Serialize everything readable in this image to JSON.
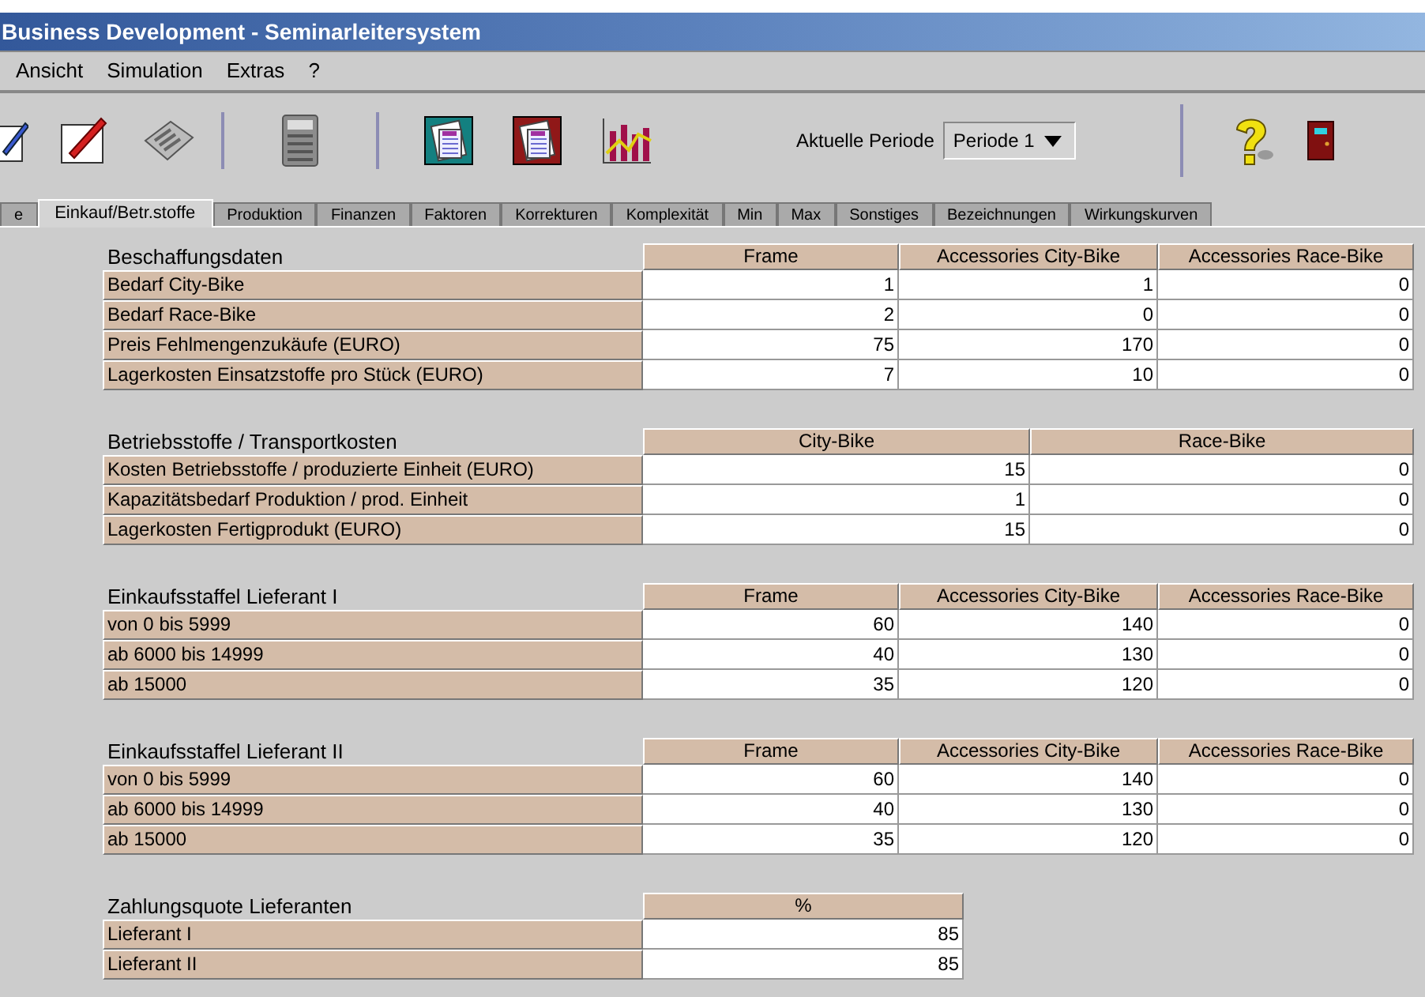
{
  "window": {
    "title": "Business Development - Seminarleitersystem"
  },
  "menu": [
    "Ansicht",
    "Simulation",
    "Extras",
    "?"
  ],
  "toolbar": {
    "period_label": "Aktuelle Periode",
    "period_value": "Periode 1"
  },
  "tabs": [
    {
      "label": "e",
      "selected": false
    },
    {
      "label": "Einkauf/Betr.stoffe",
      "selected": true
    },
    {
      "label": "Produktion",
      "selected": false
    },
    {
      "label": "Finanzen",
      "selected": false
    },
    {
      "label": "Faktoren",
      "selected": false
    },
    {
      "label": "Korrekturen",
      "selected": false
    },
    {
      "label": "Komplexität",
      "selected": false
    },
    {
      "label": "Min",
      "selected": false
    },
    {
      "label": "Max",
      "selected": false
    },
    {
      "label": "Sonstiges",
      "selected": false
    },
    {
      "label": "Bezeichnungen",
      "selected": false
    },
    {
      "label": "Wirkungskurven",
      "selected": false
    }
  ],
  "sections": [
    {
      "title": "Beschaffungsdaten",
      "columns": [
        "Frame",
        "Accessories City-Bike",
        "Accessories Race-Bike"
      ],
      "rows": [
        {
          "label": "Bedarf City-Bike",
          "cells": [
            "1",
            "1",
            "0"
          ]
        },
        {
          "label": "Bedarf Race-Bike",
          "cells": [
            "2",
            "0",
            "0"
          ]
        },
        {
          "label": "Preis Fehlmengenzukäufe (EURO)",
          "cells": [
            "75",
            "170",
            "0"
          ]
        },
        {
          "label": "Lagerkosten Einsatzstoffe pro Stück (EURO)",
          "cells": [
            "7",
            "10",
            "0"
          ]
        }
      ]
    },
    {
      "title": "Betriebsstoffe / Transportkosten",
      "columns": [
        "City-Bike",
        "Race-Bike"
      ],
      "rows": [
        {
          "label": "Kosten Betriebsstoffe / produzierte Einheit (EURO)",
          "cells": [
            "15",
            "0"
          ]
        },
        {
          "label": "Kapazitätsbedarf Produktion / prod. Einheit",
          "cells": [
            "1",
            "0"
          ]
        },
        {
          "label": "Lagerkosten Fertigprodukt (EURO)",
          "cells": [
            "15",
            "0"
          ]
        }
      ]
    },
    {
      "title": "Einkaufsstaffel Lieferant I",
      "columns": [
        "Frame",
        "Accessories City-Bike",
        "Accessories Race-Bike"
      ],
      "rows": [
        {
          "label": "von 0 bis 5999",
          "cells": [
            "60",
            "140",
            "0"
          ]
        },
        {
          "label": "ab 6000 bis 14999",
          "cells": [
            "40",
            "130",
            "0"
          ]
        },
        {
          "label": "ab 15000",
          "cells": [
            "35",
            "120",
            "0"
          ]
        }
      ]
    },
    {
      "title": "Einkaufsstaffel Lieferant II",
      "columns": [
        "Frame",
        "Accessories City-Bike",
        "Accessories Race-Bike"
      ],
      "rows": [
        {
          "label": "von 0 bis 5999",
          "cells": [
            "60",
            "140",
            "0"
          ]
        },
        {
          "label": "ab 6000 bis 14999",
          "cells": [
            "40",
            "130",
            "0"
          ]
        },
        {
          "label": "ab 15000",
          "cells": [
            "35",
            "120",
            "0"
          ]
        }
      ]
    },
    {
      "title": "Zahlungsquote Lieferanten",
      "columns": [
        "%"
      ],
      "rows": [
        {
          "label": "Lieferant I",
          "cells": [
            "85"
          ]
        },
        {
          "label": "Lieferant II",
          "cells": [
            "85"
          ]
        }
      ]
    }
  ]
}
